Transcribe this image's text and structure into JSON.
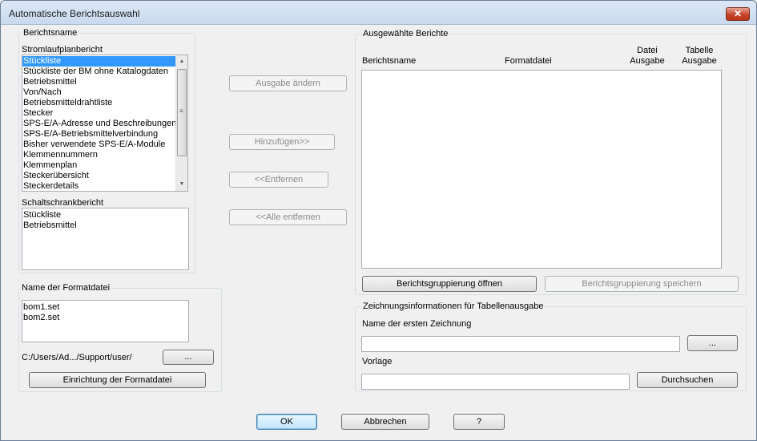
{
  "window": {
    "title": "Automatische Berichtsauswahl",
    "close_glyph": "✕"
  },
  "report_name": {
    "group_label": "Berichtsname",
    "schematic_label": "Stromlaufplanbericht",
    "schematic_items": [
      "Stückliste",
      "Stückliste der BM ohne Katalogdaten",
      "Betriebsmittel",
      "Von/Nach",
      "Betriebsmitteldrahtliste",
      "Stecker",
      "SPS-E/A-Adresse und Beschreibungen",
      "SPS-E/A-Betriebsmittelverbindung",
      "Bisher verwendete SPS-E/A-Module",
      "Klemmennummern",
      "Klemmenplan",
      "Steckerübersicht",
      "Steckerdetails"
    ],
    "schematic_selected": "Stückliste",
    "panel_label": "Schaltschrankbericht",
    "panel_items": [
      "Stückliste",
      "Betriebsmittel"
    ]
  },
  "format_file": {
    "group_label": "Name der Formatdatei",
    "files": [
      "bom1.set",
      "bom2.set"
    ],
    "path": "C:/Users/Ad.../Support/user/",
    "browse_label": "...",
    "setup_label": "Einrichtung der Formatdatei"
  },
  "actions": {
    "change_output": "Ausgabe ändern",
    "add": "Hinzufügen>>",
    "remove": "<<Entfernen",
    "remove_all": "<<Alle entfernen"
  },
  "selected_reports": {
    "group_label": "Ausgewählte Berichte",
    "columns": {
      "report_name": "Berichtsname",
      "format_file": "Formatdatei",
      "file_output_l1": "Datei",
      "file_output_l2": "Ausgabe",
      "table_output_l1": "Tabelle",
      "table_output_l2": "Ausgabe"
    },
    "open_grouping": "Berichtsgruppierung öffnen",
    "save_grouping": "Berichtsgruppierung speichern"
  },
  "drawing_info": {
    "group_label": "Zeichnungsinformationen für Tabellenausgabe",
    "first_drawing_label": "Name der ersten Zeichnung",
    "first_drawing_value": "",
    "browse_label": "...",
    "template_label": "Vorlage",
    "template_value": "",
    "search_label": "Durchsuchen"
  },
  "footer": {
    "ok": "OK",
    "cancel": "Abbrechen",
    "help": "?"
  },
  "icons": {
    "scroll_up": "▲",
    "scroll_down": "▼",
    "grip": "≡"
  }
}
